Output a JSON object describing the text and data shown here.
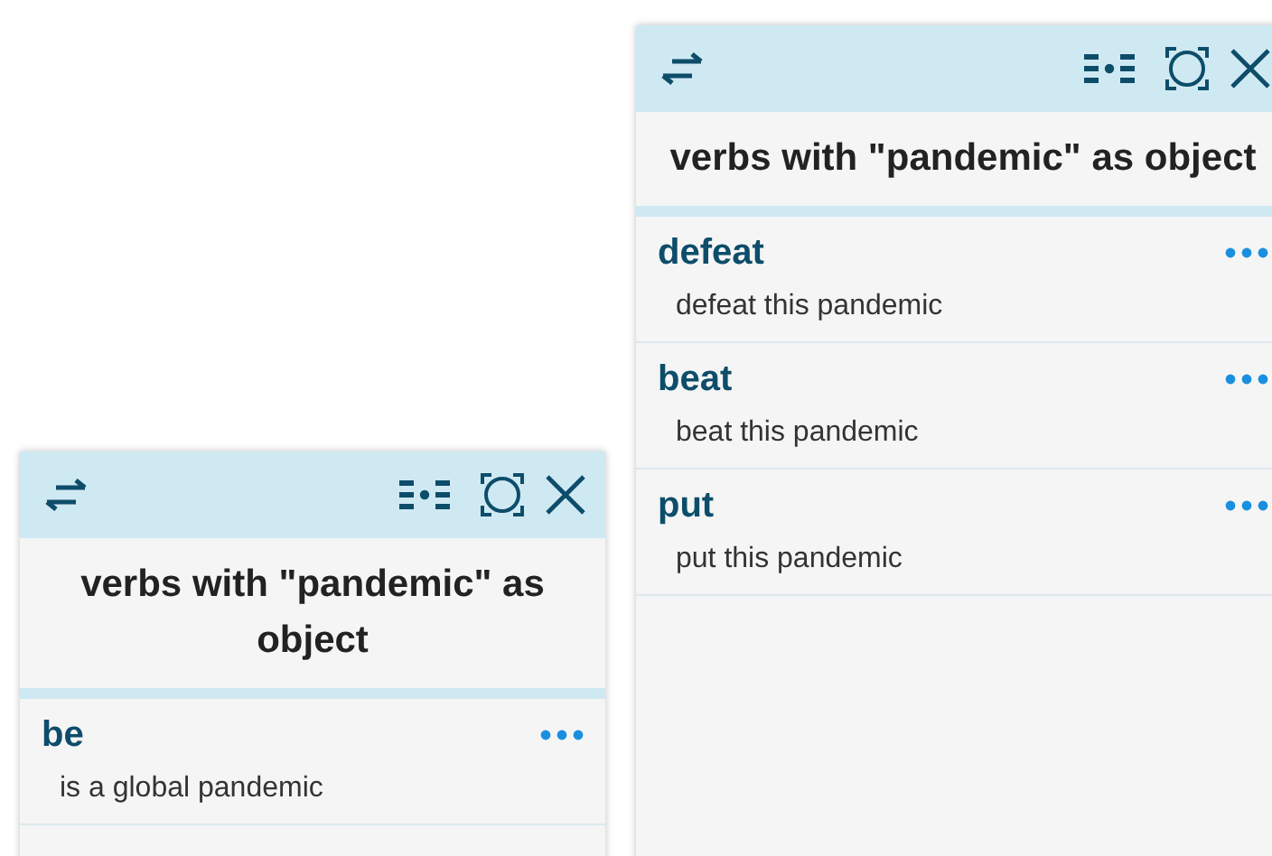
{
  "panels": [
    {
      "title": "verbs with \"pandemic\" as object",
      "entries": [
        {
          "verb": "be",
          "example": "is a global pandemic"
        }
      ]
    },
    {
      "title": "verbs with \"pandemic\" as object",
      "entries": [
        {
          "verb": "defeat",
          "example": "defeat this pandemic"
        },
        {
          "verb": "beat",
          "example": "beat this pandemic"
        },
        {
          "verb": "put",
          "example": "put this pandemic"
        }
      ]
    }
  ]
}
